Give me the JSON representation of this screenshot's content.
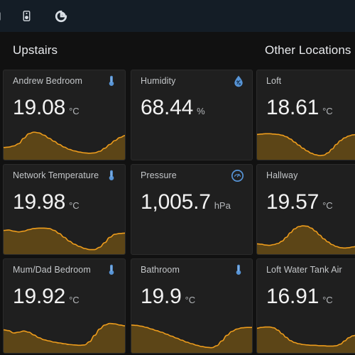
{
  "topbar": {
    "icons": [
      {
        "name": "panel-left-icon",
        "label": "panel"
      },
      {
        "name": "speaker-icon",
        "label": "speaker"
      },
      {
        "name": "donut-chart-icon",
        "label": "donut chart"
      }
    ],
    "background": "#141d26"
  },
  "sections": [
    {
      "title": "Upstairs"
    },
    {
      "title": "Other Locations"
    }
  ],
  "colors": {
    "page_background": "#111111",
    "card_background": "#1f1f1f",
    "card_border": "#2b2b2b",
    "sparkline_stroke": "#ed9c1c",
    "sparkline_fill": "#5c4517",
    "icon_blue": "#5794d6",
    "value_text": "#f2f2f2",
    "unit_text": "#b5b8bb",
    "title_text": "#c4c7ca",
    "header_text": "#e8eaed"
  },
  "cards": [
    {
      "id": "andrew-bedroom",
      "title": "Andrew Bedroom",
      "value": "19.08",
      "unit": "°C",
      "icon": "thermometer-icon",
      "has_sparkline": true,
      "sparkline": [
        0.32,
        0.33,
        0.36,
        0.42,
        0.56,
        0.68,
        0.72,
        0.7,
        0.64,
        0.56,
        0.48,
        0.4,
        0.33,
        0.27,
        0.23,
        0.2,
        0.18,
        0.17,
        0.18,
        0.22,
        0.3,
        0.4,
        0.5,
        0.58,
        0.63
      ]
    },
    {
      "id": "humidity",
      "title": "Humidity",
      "value": "68.44",
      "unit": "%",
      "icon": "water-drop-icon",
      "has_sparkline": false,
      "sparkline": []
    },
    {
      "id": "loft",
      "title": "Loft",
      "value": "18.61",
      "unit": "°C",
      "icon": "none",
      "has_sparkline": true,
      "sparkline": [
        0.66,
        0.67,
        0.68,
        0.68,
        0.67,
        0.66,
        0.64,
        0.6,
        0.54,
        0.46,
        0.38,
        0.3,
        0.23,
        0.17,
        0.13,
        0.11,
        0.12,
        0.18,
        0.28,
        0.4,
        0.5,
        0.57,
        0.62,
        0.65,
        0.66
      ]
    },
    {
      "id": "network-temperature",
      "title": "Network Temperature",
      "value": "19.98",
      "unit": "°C",
      "icon": "thermometer-icon",
      "has_sparkline": true,
      "sparkline": [
        0.62,
        0.63,
        0.6,
        0.58,
        0.6,
        0.64,
        0.67,
        0.68,
        0.68,
        0.67,
        0.62,
        0.54,
        0.44,
        0.34,
        0.26,
        0.2,
        0.15,
        0.12,
        0.12,
        0.18,
        0.3,
        0.44,
        0.52,
        0.54,
        0.55
      ]
    },
    {
      "id": "pressure",
      "title": "Pressure",
      "value": "1,005.7",
      "unit": "hPa",
      "icon": "gauge-icon",
      "has_sparkline": false,
      "sparkline": []
    },
    {
      "id": "hallway",
      "title": "Hallway",
      "value": "19.57",
      "unit": "°C",
      "icon": "none",
      "has_sparkline": true,
      "sparkline": [
        0.27,
        0.26,
        0.24,
        0.23,
        0.25,
        0.28,
        0.34,
        0.44,
        0.56,
        0.66,
        0.72,
        0.74,
        0.73,
        0.68,
        0.6,
        0.5,
        0.4,
        0.32,
        0.25,
        0.2,
        0.17,
        0.16,
        0.17,
        0.19,
        0.21
      ]
    },
    {
      "id": "mum-dad-bedroom",
      "title": "Mum/Dad Bedroom",
      "value": "19.92",
      "unit": "°C",
      "icon": "thermometer-icon",
      "has_sparkline": true,
      "sparkline": [
        0.58,
        0.56,
        0.5,
        0.52,
        0.55,
        0.52,
        0.45,
        0.38,
        0.33,
        0.3,
        0.27,
        0.25,
        0.23,
        0.21,
        0.2,
        0.19,
        0.2,
        0.28,
        0.44,
        0.6,
        0.7,
        0.74,
        0.73,
        0.7,
        0.68
      ]
    },
    {
      "id": "bathroom",
      "title": "Bathroom",
      "value": "19.9",
      "unit": "°C",
      "icon": "thermometer-icon",
      "has_sparkline": true,
      "sparkline": [
        0.7,
        0.69,
        0.67,
        0.64,
        0.6,
        0.56,
        0.52,
        0.47,
        0.42,
        0.37,
        0.32,
        0.27,
        0.23,
        0.19,
        0.16,
        0.14,
        0.13,
        0.18,
        0.3,
        0.44,
        0.54,
        0.6,
        0.63,
        0.64,
        0.64
      ]
    },
    {
      "id": "loft-water-tank-air",
      "title": "Loft Water Tank Air",
      "value": "16.91",
      "unit": "°C",
      "icon": "none",
      "has_sparkline": true,
      "sparkline": [
        0.62,
        0.64,
        0.65,
        0.65,
        0.63,
        0.57,
        0.48,
        0.39,
        0.31,
        0.26,
        0.23,
        0.21,
        0.2,
        0.19,
        0.19,
        0.18,
        0.18,
        0.17,
        0.17,
        0.18,
        0.22,
        0.3,
        0.38,
        0.43,
        0.45
      ]
    }
  ]
}
